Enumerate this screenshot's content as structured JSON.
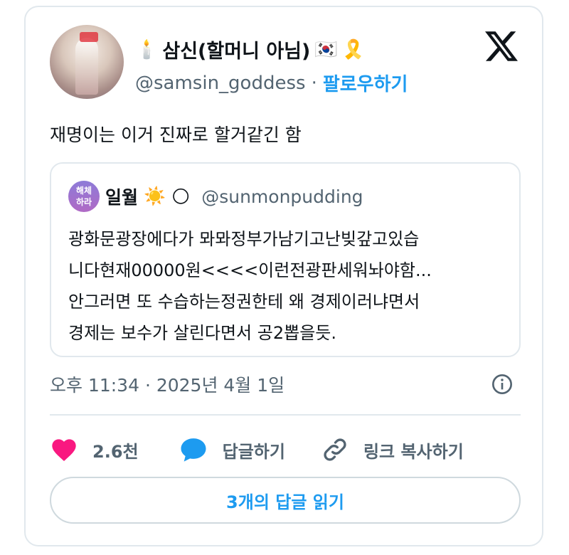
{
  "tweet": {
    "display_name": "삼신(할머니 아님)",
    "name_prefix_emoji": "🕯️",
    "name_suffix_emojis": [
      "🇰🇷",
      "🎗️"
    ],
    "handle": "@samsin_goddess",
    "separator": "·",
    "follow_label": "팔로우하기",
    "text": "재명이는 이거 진짜로 할거같긴 함"
  },
  "quoted_tweet": {
    "avatar_text": "해체\n하라",
    "display_name": "일월",
    "name_emojis": [
      "☀️",
      "🌕"
    ],
    "handle": "@sunmonpudding",
    "lines": [
      "광화문광장에다가 뫄뫄정부가남기고난빚갚고있습",
      "니다현재00000원<<<<이런전광판세워놔야함...",
      "안그러면 또 수습하는정권한테 왜 경제이러냐면서",
      "경제는 보수가 살린다면서 공2뽑을듯."
    ]
  },
  "meta": {
    "timestamp": "오후 11:34 · 2025년 4월 1일"
  },
  "actions": {
    "like_count": "2.6천",
    "reply_label": "답글하기",
    "copy_link_label": "링크 복사하기"
  },
  "read_replies_label": "3개의 답글 읽기",
  "icons": {
    "logo": "x-logo-icon",
    "info": "info-icon",
    "like": "heart-icon",
    "reply": "reply-bubble-icon",
    "link": "link-icon"
  },
  "colors": {
    "accent": "#1d9bf0",
    "heart": "#f91880",
    "muted": "#536471"
  }
}
